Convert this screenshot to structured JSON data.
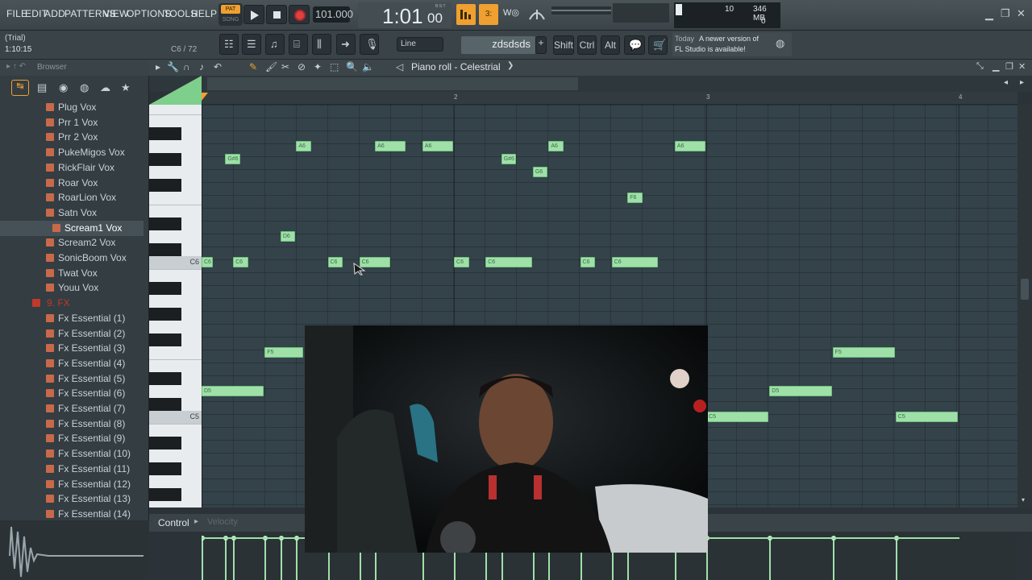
{
  "menubar": {
    "items": [
      "FILE",
      "EDIT",
      "ADD",
      "PATTERNS",
      "VIEW",
      "OPTIONS",
      "TOOLS",
      "HELP"
    ],
    "pat_label": "PAT",
    "song_label": "SONG",
    "tempo": "101.000",
    "time": "1:01",
    "time_ticks": "00",
    "time_unit": "B:S:T",
    "cpu_value": "10",
    "memory": "346 MB",
    "polyphony": "0"
  },
  "toolbar2": {
    "trial": "(Trial)",
    "position": "1:10:15",
    "note_info": "C6 / 72",
    "snap_mode": "Line",
    "pattern_name": "zdsdsds",
    "shift_label": "Shift",
    "ctrl_label": "Ctrl",
    "alt_label": "Alt",
    "news_day": "Today",
    "news_text_1": "A newer version of",
    "news_text_2": "FL Studio is available!"
  },
  "browser": {
    "title": "Browser",
    "folder_fx": "9. FX",
    "items": [
      "Plug Vox",
      "Prr 1 Vox",
      "Prr 2 Vox",
      "PukeMigos Vox",
      "RickFlair Vox",
      "Roar Vox",
      "RoarLion Vox",
      "Satn Vox",
      "Scream1 Vox",
      "Scream2 Vox",
      "SonicBoom Vox",
      "Twat Vox",
      "Youu Vox"
    ],
    "fx_items": [
      "Fx Essential (1)",
      "Fx Essential (2)",
      "Fx Essential (3)",
      "Fx Essential (4)",
      "Fx Essential (5)",
      "Fx Essential (6)",
      "Fx Essential (7)",
      "Fx Essential (8)",
      "Fx Essential (9)",
      "Fx Essential (10)",
      "Fx Essential (11)",
      "Fx Essential (12)",
      "Fx Essential (13)",
      "Fx Essential (14)"
    ],
    "selected": "Scream1 Vox"
  },
  "piano_roll": {
    "title": "Piano roll - Celestrial",
    "bars": [
      "2",
      "3",
      "4"
    ],
    "key_labels": [
      "C6",
      "C5"
    ],
    "control_label": "Control",
    "control_param": "Velocity",
    "notes": [
      {
        "label": "C6",
        "pitch": "C6",
        "start": 0,
        "length": 0.25
      },
      {
        "label": "G#6",
        "pitch": "G#6",
        "start": 0.75,
        "length": 0.5
      },
      {
        "label": "C6",
        "pitch": "C6",
        "start": 1,
        "length": 0.5
      },
      {
        "label": "D6",
        "pitch": "D6",
        "start": 2.5,
        "length": 0.5
      },
      {
        "label": "A6",
        "pitch": "A6",
        "start": 3,
        "length": 0.5
      },
      {
        "label": "C6",
        "pitch": "C6",
        "start": 4,
        "length": 0.5
      },
      {
        "label": "C6",
        "pitch": "C6",
        "start": 5,
        "length": 1
      },
      {
        "label": "A6",
        "pitch": "A6",
        "start": 5.5,
        "length": 1
      },
      {
        "label": "A6",
        "pitch": "A6",
        "start": 7,
        "length": 1
      },
      {
        "label": "C6",
        "pitch": "C6",
        "start": 8,
        "length": 0.5
      },
      {
        "label": "C6",
        "pitch": "C6",
        "start": 9,
        "length": 1.5
      },
      {
        "label": "G#6",
        "pitch": "G#6",
        "start": 9.5,
        "length": 0.5
      },
      {
        "label": "G6",
        "pitch": "G6",
        "start": 10.5,
        "length": 0.5
      },
      {
        "label": "A6",
        "pitch": "A6",
        "start": 11,
        "length": 0.5
      },
      {
        "label": "C6",
        "pitch": "C6",
        "start": 12,
        "length": 0.5
      },
      {
        "label": "C6",
        "pitch": "C6",
        "start": 13,
        "length": 1.5
      },
      {
        "label": "F6",
        "pitch": "F6",
        "start": 13.5,
        "length": 0.5
      },
      {
        "label": "A6",
        "pitch": "A6",
        "start": 15,
        "length": 1
      },
      {
        "label": "F5",
        "pitch": "F5",
        "start": 2,
        "length": 1.25
      },
      {
        "label": "D5",
        "pitch": "D5",
        "start": 0,
        "length": 2
      },
      {
        "label": "C5",
        "pitch": "C5",
        "start": 16,
        "length": 2
      },
      {
        "label": "D5",
        "pitch": "D5",
        "start": 18,
        "length": 2
      },
      {
        "label": "F5",
        "pitch": "F5",
        "start": 20,
        "length": 2
      },
      {
        "label": "C5",
        "pitch": "C5",
        "start": 22,
        "length": 2
      }
    ],
    "colors": {
      "note": "#9fe0a8",
      "grid": "#34424a",
      "accent": "#f0a030"
    }
  }
}
